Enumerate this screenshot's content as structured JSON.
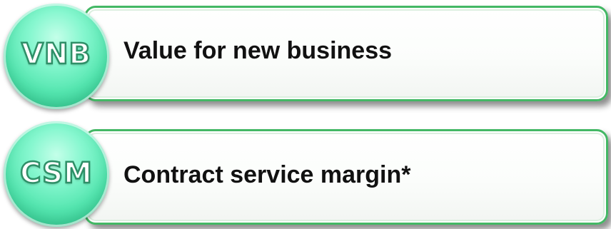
{
  "items": [
    {
      "badge": "VNB",
      "label": "Value for new business"
    },
    {
      "badge": "CSM",
      "label": "Contract service margin*"
    }
  ],
  "colors": {
    "card_border": "#43b865",
    "badge_fill": "#55e6b0",
    "badge_outline": "#2e8f67",
    "text": "#111111"
  }
}
